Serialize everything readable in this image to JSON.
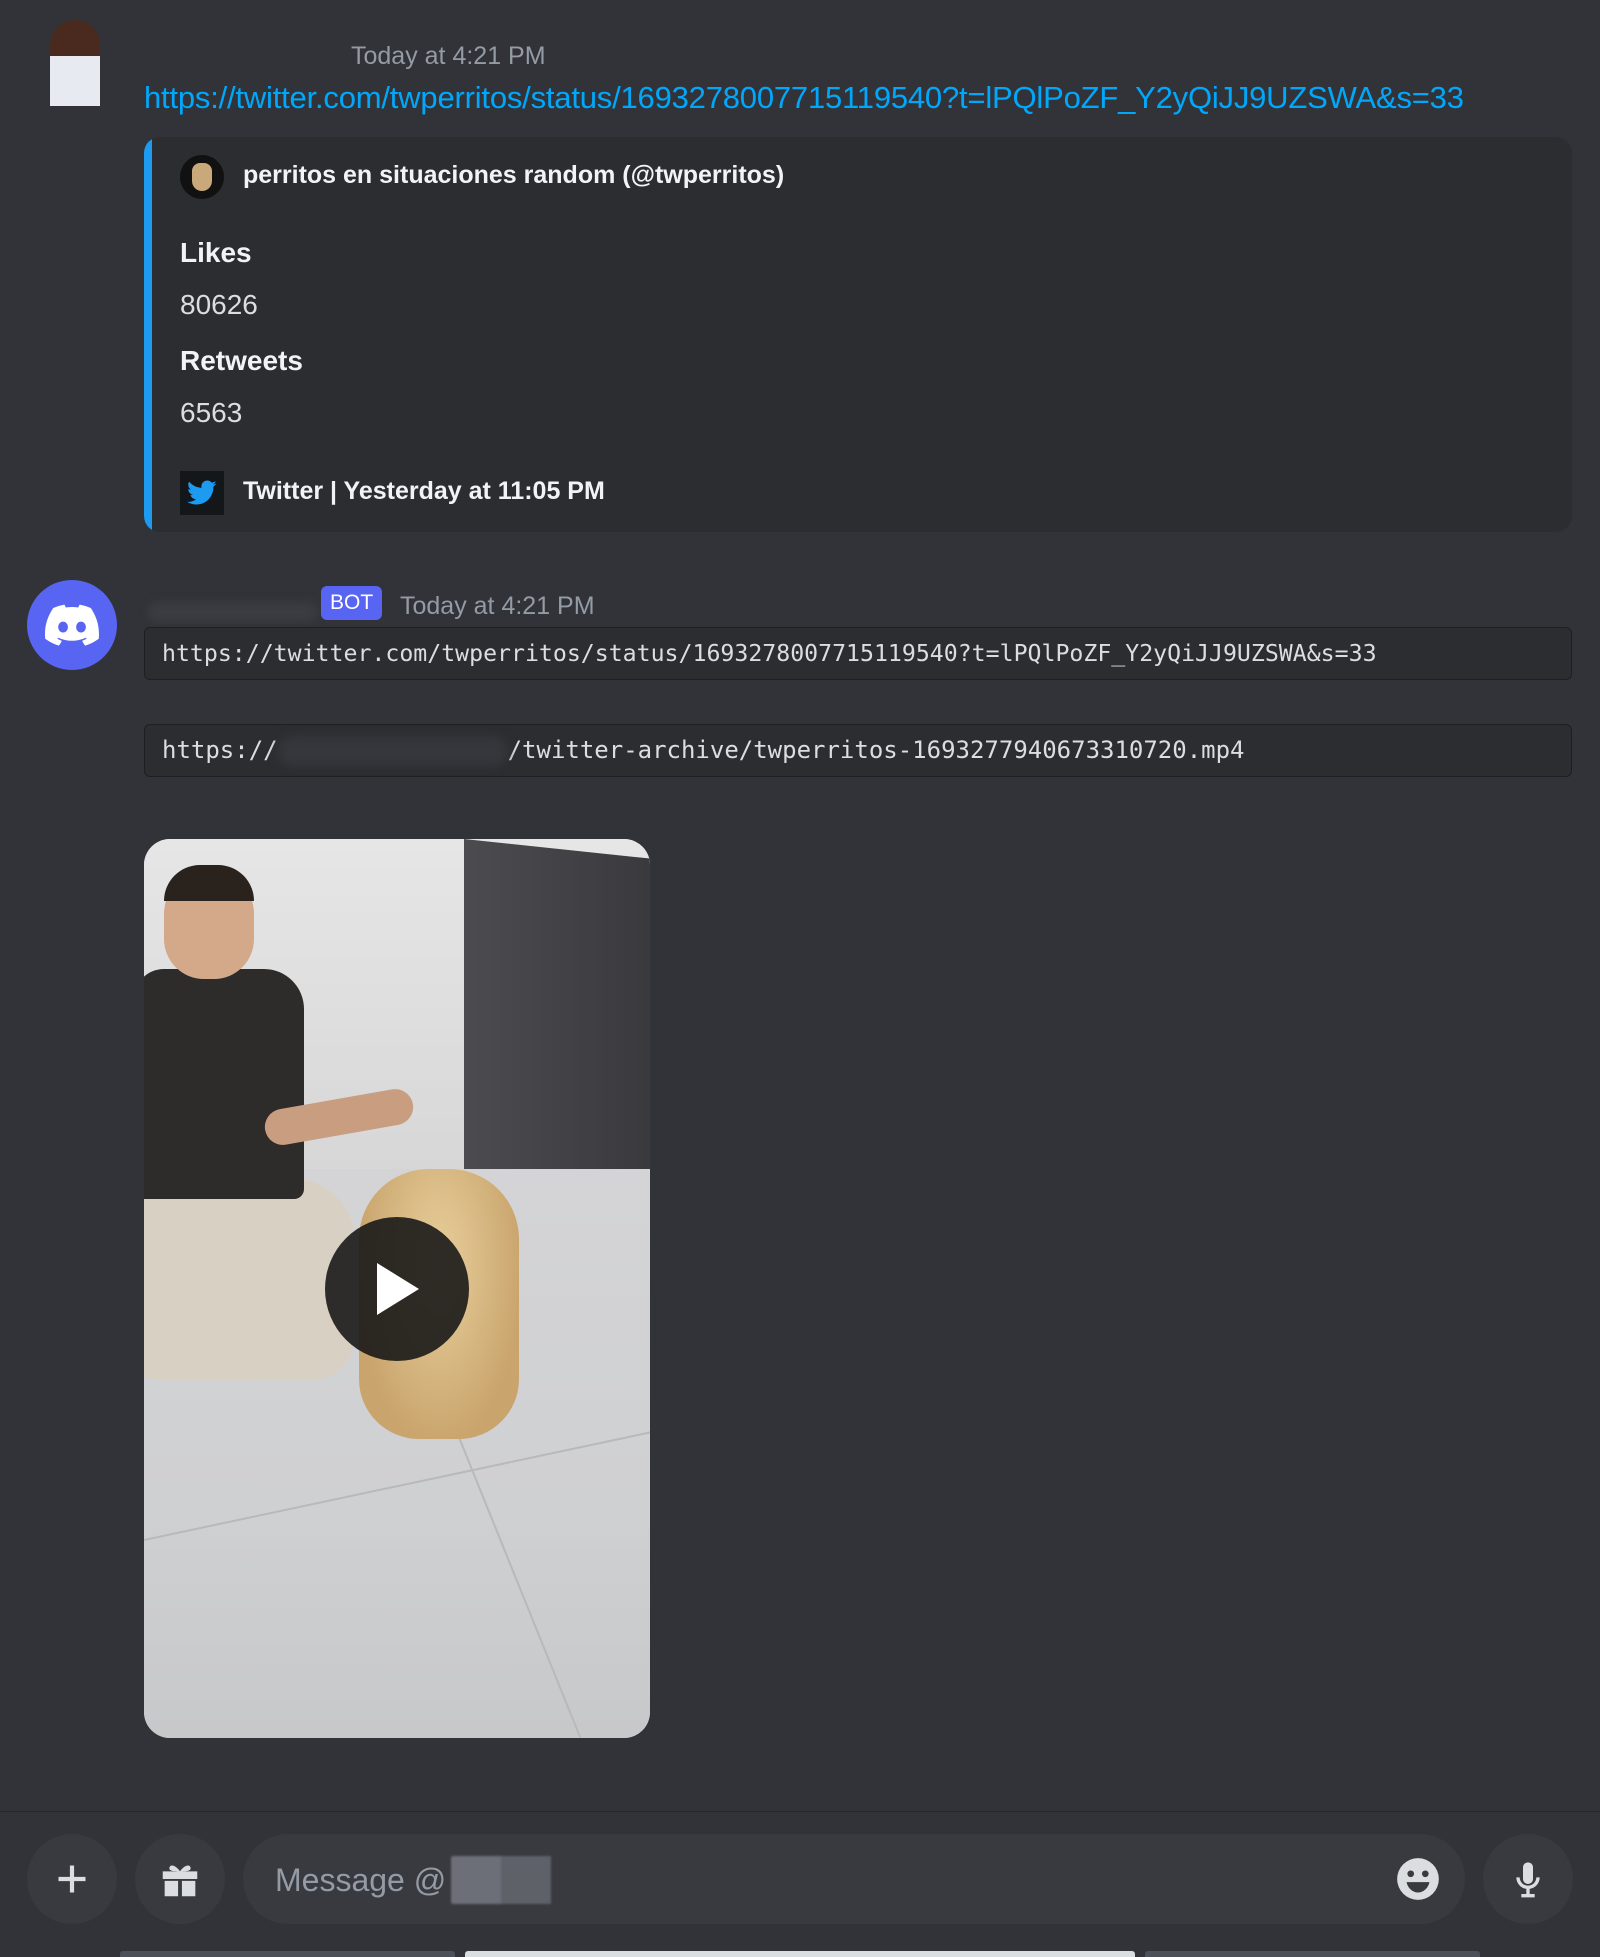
{
  "message1": {
    "timestamp": "Today at 4:21 PM",
    "link": "https://twitter.com/twperritos/status/1693278007715119540?t=lPQlPoZF_Y2yQiJJ9UZSWA&s=33",
    "embed": {
      "accent_color": "#1d9bf0",
      "author": "perritos en situaciones random (@twperritos)",
      "fields": [
        {
          "name": "Likes",
          "value": "80626"
        },
        {
          "name": "Retweets",
          "value": "6563"
        }
      ],
      "footer": "Twitter | Yesterday at 11:05 PM",
      "footer_icon": "twitter-bird-icon"
    }
  },
  "message2": {
    "bot_tag": "BOT",
    "timestamp": "Today at 4:21 PM",
    "code_blocks": [
      {
        "text": "https://twitter.com/twperritos/status/1693278007715119540?t=lPQlPoZF_Y2yQiJJ9UZSWA&s=33"
      },
      {
        "prefix": "https://",
        "suffix": "/twitter-archive/twperritos-1693277940673310720.mp4"
      }
    ],
    "video": {
      "play_icon": "play-icon"
    }
  },
  "input_bar": {
    "placeholder": "Message @",
    "icons": {
      "attach": "plus-icon",
      "gift": "gift-icon",
      "emoji": "emoji-icon",
      "voice": "microphone-icon"
    }
  },
  "colors": {
    "background": "#313338",
    "embed_bg": "#2b2d31",
    "link": "#00a8fc",
    "blurple": "#5865f2",
    "muted_text": "#949ba4"
  }
}
